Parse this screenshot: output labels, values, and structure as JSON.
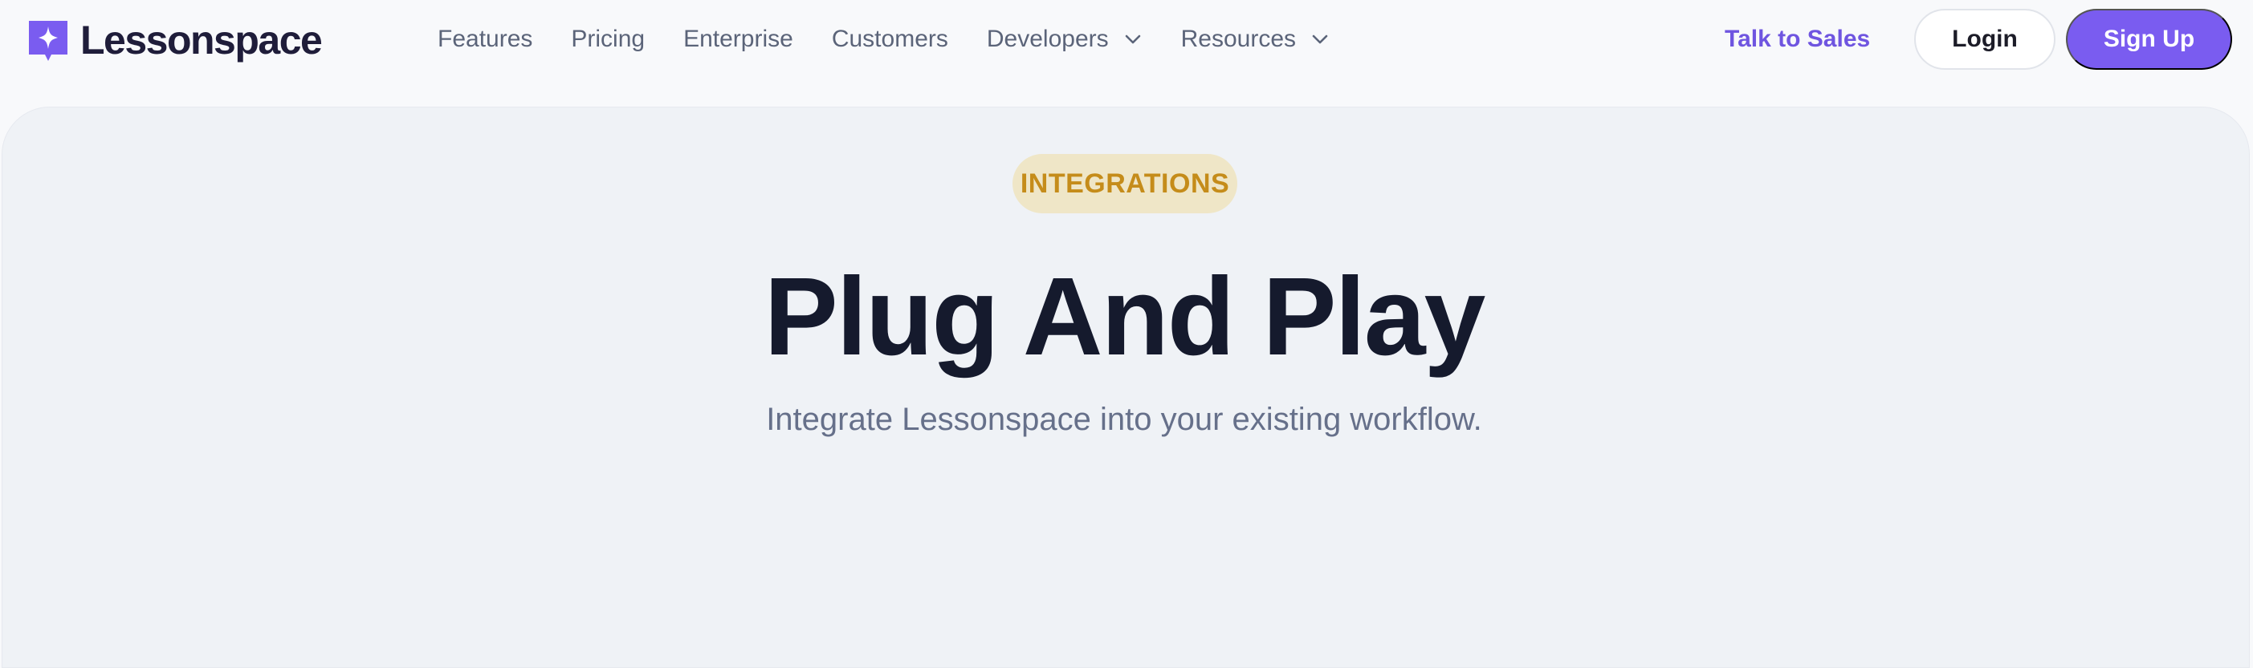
{
  "brand": {
    "name": "Lessonspace",
    "color": "#7a5cf0"
  },
  "nav": {
    "links": [
      {
        "label": "Features"
      },
      {
        "label": "Pricing"
      },
      {
        "label": "Enterprise"
      },
      {
        "label": "Customers"
      },
      {
        "label": "Developers",
        "icon": "chevron-down-icon"
      },
      {
        "label": "Resources",
        "icon": "chevron-down-icon"
      }
    ],
    "talk_to_sales": "Talk to Sales",
    "login": "Login",
    "signup": "Sign Up"
  },
  "hero": {
    "badge": "INTEGRATIONS",
    "title": "Plug And Play",
    "subtitle": "Integrate Lessonspace into your existing workflow."
  },
  "colors": {
    "accent": "#7a5cf0",
    "talk_to_sales": "#6f55e0",
    "badge_bg": "#efe6c7",
    "badge_text": "#c58c1a",
    "title": "#151a2d",
    "nav_text": "#5b6479"
  }
}
